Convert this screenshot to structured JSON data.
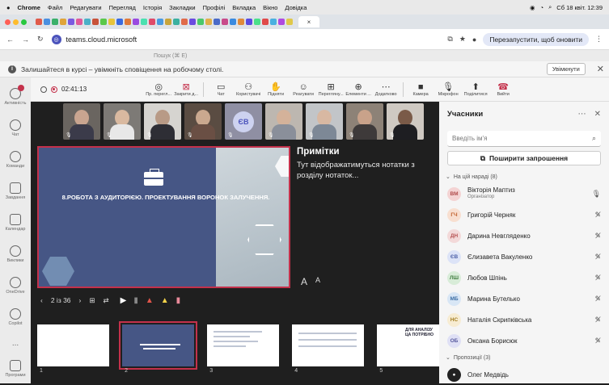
{
  "mac_menu": {
    "apple": "",
    "items": [
      "Chrome",
      "Файл",
      "Редагувати",
      "Перегляд",
      "Історія",
      "Закладки",
      "Профілі",
      "Вкладка",
      "Вікно",
      "Довідка"
    ],
    "clock": "Сб 18 квіт. 12:39"
  },
  "browser": {
    "url": "teams.cloud.microsoft",
    "relaunch_label": "Перезапустити, щоб оновити",
    "tab_close": "×"
  },
  "teams_top": {
    "search_placeholder": "Пошук (⌘ Е)"
  },
  "notification": {
    "text": "Залишайтеся в курсі – увімкніть сповіщення на робочому столі.",
    "button": "Увімкнути"
  },
  "rail": [
    {
      "label": "Активність",
      "icon": "bell-icon"
    },
    {
      "label": "Чат",
      "icon": "chat-icon"
    },
    {
      "label": "Команди",
      "icon": "teams-icon"
    },
    {
      "label": "Завдання",
      "icon": "tasks-icon"
    },
    {
      "label": "Календар",
      "icon": "calendar-icon"
    },
    {
      "label": "Виклики",
      "icon": "phone-icon"
    },
    {
      "label": "OneDrive",
      "icon": "cloud-icon"
    },
    {
      "label": "Copilot",
      "icon": "copilot-icon"
    },
    {
      "label": "...",
      "icon": "more-icon"
    },
    {
      "label": "Програми",
      "icon": "apps-icon"
    }
  ],
  "meeting": {
    "timer": "02:41:13",
    "toolbar": [
      {
        "label": "Пр. перегл...",
        "glyph": "◎"
      },
      {
        "label": "Закрити д...",
        "glyph": "⊠"
      },
      {
        "label": "Чат",
        "glyph": "▭"
      },
      {
        "label": "Користувачі",
        "glyph": "⚇"
      },
      {
        "label": "Підняти",
        "glyph": "✋"
      },
      {
        "label": "Реагувати",
        "glyph": "☺"
      },
      {
        "label": "Перегляну...",
        "glyph": "⊞"
      },
      {
        "label": "Елементи ...",
        "glyph": "⊕"
      },
      {
        "label": "Додатково",
        "glyph": "⋯"
      },
      {
        "label": "Камера",
        "glyph": "■"
      },
      {
        "label": "Мікрофон",
        "glyph": "🎙"
      },
      {
        "label": "Поділитися",
        "glyph": "⬆"
      },
      {
        "label": "Вийти",
        "glyph": "☎"
      }
    ]
  },
  "video_tiles": [
    {
      "initials": "",
      "mic": "🎙"
    },
    {
      "initials": "",
      "mic": "🎙"
    },
    {
      "initials": "",
      "mic": "🎙"
    },
    {
      "initials": "",
      "mic": "🎙"
    },
    {
      "initials": "ЄВ",
      "mic": "🎙"
    },
    {
      "initials": "",
      "mic": "🎙"
    },
    {
      "initials": "",
      "mic": "🎙"
    },
    {
      "initials": "",
      "mic": "🎙"
    },
    {
      "initials": "",
      "mic": "🎙"
    }
  ],
  "slide": {
    "title": "8.РОБОТА З АУДИТОРІЄЮ. ПРОЕКТУВАННЯ ВОРОНОК ЗАЛУЧЕННЯ."
  },
  "notes": {
    "heading": "Примітки",
    "text": "Тут відображатимуться нотатки з розділу нотаток...",
    "font_up": "A",
    "font_down": "A"
  },
  "slide_controls": {
    "counter": "2 із 36"
  },
  "thumbnails": [
    "1",
    "2",
    "3",
    "4",
    "5"
  ],
  "thumb5_text": "ДЛЯ АНАЛІЗУ ЦА ПОТРІБНО",
  "participants": {
    "title": "Учасники",
    "search_placeholder": "Введіть ім'я",
    "share_label": "Поширити запрошення",
    "in_meeting_label": "На цій нараді (8)",
    "suggestions_label": "Пропозиції (3)",
    "people": [
      {
        "initials": "ВМ",
        "name": "Вікторія Маптиз",
        "role": "Організатор",
        "bg": "#f4d3d3",
        "fg": "#b04b4b",
        "muted": false
      },
      {
        "initials": "ГЧ",
        "name": "Григорій Черняк",
        "role": "",
        "bg": "#f8dfd0",
        "fg": "#c0602c",
        "muted": true
      },
      {
        "initials": "ДН",
        "name": "Дарина Невгляденко",
        "role": "",
        "bg": "#f3d9d9",
        "fg": "#b65252",
        "muted": true
      },
      {
        "initials": "ЄВ",
        "name": "Єлизавета Вакуленко",
        "role": "",
        "bg": "#dce3f7",
        "fg": "#4b5fa6",
        "muted": true
      },
      {
        "initials": "ЛШ",
        "name": "Любов Шпінь",
        "role": "",
        "bg": "#d8ecd8",
        "fg": "#3e7b3e",
        "muted": true
      },
      {
        "initials": "МБ",
        "name": "Марина Бутелько",
        "role": "",
        "bg": "#d8e6f5",
        "fg": "#3c6ea5",
        "muted": true
      },
      {
        "initials": "НС",
        "name": "Наталія Скрипківська",
        "role": "",
        "bg": "#f7ecd2",
        "fg": "#a27c20",
        "muted": true
      },
      {
        "initials": "ОБ",
        "name": "Оксана Борисюк",
        "role": "",
        "bg": "#dfe0f5",
        "fg": "#55579c",
        "muted": true
      }
    ],
    "suggested": [
      {
        "name": "Олег Медвідь"
      }
    ]
  }
}
